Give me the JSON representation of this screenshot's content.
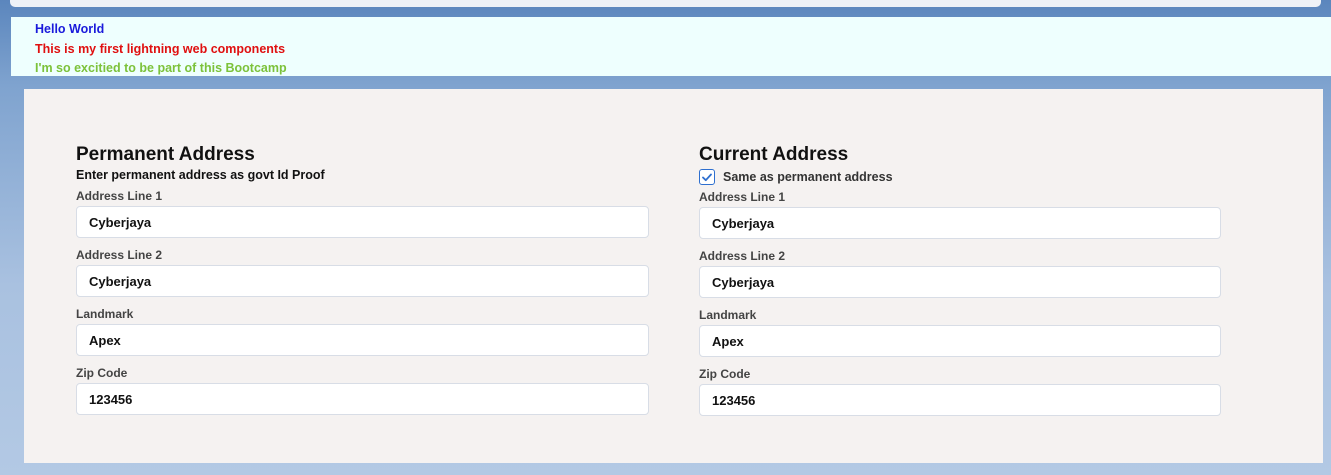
{
  "greeting": {
    "line1": "Hello World",
    "line2": "This is my first lightning web components",
    "line3": "I'm so excitied to be part of this Bootcamp",
    "colors": {
      "line1": "#1a1adb",
      "line2": "#e01010",
      "line3": "#7cc23a"
    }
  },
  "permanent": {
    "title": "Permanent Address",
    "subtitle": "Enter permanent address as govt Id Proof",
    "fields": [
      {
        "label": "Address Line 1",
        "value": "Cyberjaya"
      },
      {
        "label": "Address Line 2",
        "value": "Cyberjaya"
      },
      {
        "label": "Landmark",
        "value": "Apex"
      },
      {
        "label": "Zip Code",
        "value": "123456"
      }
    ]
  },
  "current": {
    "title": "Current Address",
    "same_as_label": "Same as permanent address",
    "same_as_checked": true,
    "fields": [
      {
        "label": "Address Line 1",
        "value": "Cyberjaya"
      },
      {
        "label": "Address Line 2",
        "value": "Cyberjaya"
      },
      {
        "label": "Landmark",
        "value": "Apex"
      },
      {
        "label": "Zip Code",
        "value": "123456"
      }
    ]
  },
  "icons": {
    "checkbox": "check-icon"
  },
  "accent": "#2e6fcf"
}
